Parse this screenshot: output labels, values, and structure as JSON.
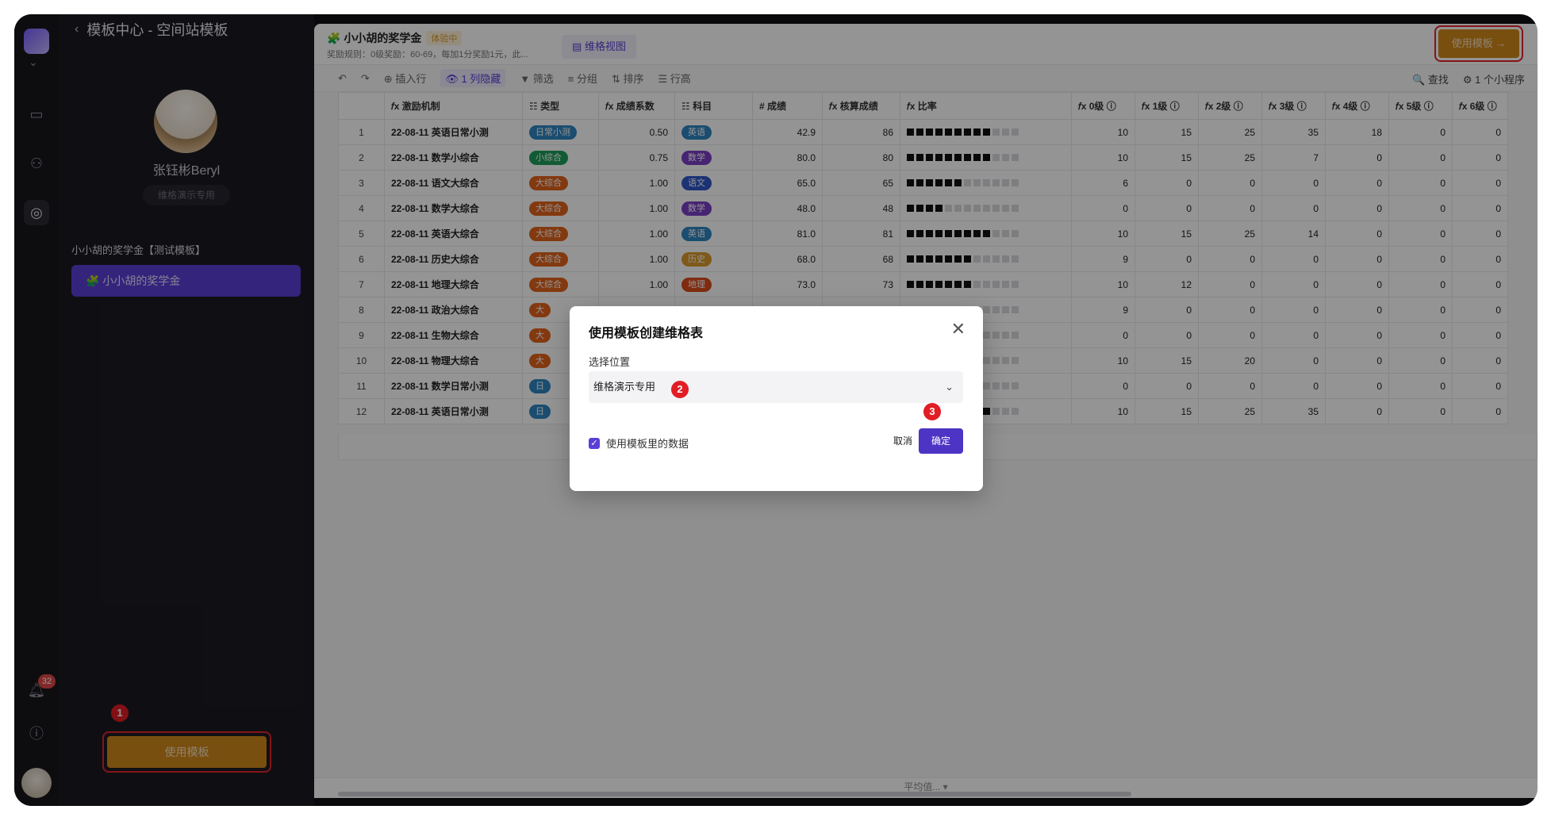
{
  "rail": {
    "badge_count": "32"
  },
  "side": {
    "header": "模板中心 - 空间站模板",
    "user_name": "张钰彬Beryl",
    "user_tag": "维格演示专用",
    "section_title": "小小胡的奖学金【测试模板】",
    "selected_item": "🧩 小小胡的奖学金",
    "use_button": "使用模板"
  },
  "doc": {
    "title": "🧩 小小胡的奖学金",
    "trial_tag": "体验中",
    "desc": "奖励规则：0级奖励：60-69，每加1分奖励1元，此...",
    "view_tab": "▤ 维格视图",
    "top_use_button": "使用模板 →"
  },
  "toolbar": {
    "insert": "⊕ 插入行",
    "hidden": "👁 1 列隐藏",
    "filter": "▼ 筛选",
    "group": "≡ 分组",
    "sort": "⇅ 排序",
    "row_height": "☰ 行高",
    "find": "🔍 查找",
    "widgets": "⚙ 1 个小程序"
  },
  "table": {
    "headers": [
      "",
      "𝑓x 激励机制",
      "☷ 类型",
      "𝑓x 成绩系数",
      "☷ 科目",
      "# 成绩",
      "𝑓x 核算成绩",
      "𝑓x 比率",
      "𝑓x 0级 ⓘ",
      "𝑓x 1级 ⓘ",
      "𝑓x 2级 ⓘ",
      "𝑓x 3级 ⓘ",
      "𝑓x 4级 ⓘ",
      "𝑓x 5级 ⓘ",
      "𝑓x 6级 ⓘ"
    ],
    "rows": [
      {
        "n": "1",
        "mech": "22-08-11 英语日常小测",
        "type": "日常小测",
        "tc": "#2e86c1",
        "coef": "0.50",
        "subj": "英语",
        "sc": "#2e86c1",
        "score": "42.9",
        "calc": "86",
        "rate": 9,
        "l0": "10",
        "l1": "15",
        "l2": "25",
        "l3": "35",
        "l4": "18",
        "l5": "0",
        "l6": "0"
      },
      {
        "n": "2",
        "mech": "22-08-11 数学小综合",
        "type": "小综合",
        "tc": "#1e9e5a",
        "coef": "0.75",
        "subj": "数学",
        "sc": "#7b3fc7",
        "score": "80.0",
        "calc": "80",
        "rate": 9,
        "l0": "10",
        "l1": "15",
        "l2": "25",
        "l3": "7",
        "l4": "0",
        "l5": "0",
        "l6": "0"
      },
      {
        "n": "3",
        "mech": "22-08-11 语文大综合",
        "type": "大综合",
        "tc": "#e2621b",
        "coef": "1.00",
        "subj": "语文",
        "sc": "#3057c9",
        "score": "65.0",
        "calc": "65",
        "rate": 6,
        "l0": "6",
        "l1": "0",
        "l2": "0",
        "l3": "0",
        "l4": "0",
        "l5": "0",
        "l6": "0"
      },
      {
        "n": "4",
        "mech": "22-08-11 数学大综合",
        "type": "大综合",
        "tc": "#e2621b",
        "coef": "1.00",
        "subj": "数学",
        "sc": "#7b3fc7",
        "score": "48.0",
        "calc": "48",
        "rate": 4,
        "l0": "0",
        "l1": "0",
        "l2": "0",
        "l3": "0",
        "l4": "0",
        "l5": "0",
        "l6": "0"
      },
      {
        "n": "5",
        "mech": "22-08-11 英语大综合",
        "type": "大综合",
        "tc": "#e2621b",
        "coef": "1.00",
        "subj": "英语",
        "sc": "#2e86c1",
        "score": "81.0",
        "calc": "81",
        "rate": 9,
        "l0": "10",
        "l1": "15",
        "l2": "25",
        "l3": "14",
        "l4": "0",
        "l5": "0",
        "l6": "0"
      },
      {
        "n": "6",
        "mech": "22-08-11 历史大综合",
        "type": "大综合",
        "tc": "#e2621b",
        "coef": "1.00",
        "subj": "历史",
        "sc": "#d99a2b",
        "score": "68.0",
        "calc": "68",
        "rate": 7,
        "l0": "9",
        "l1": "0",
        "l2": "0",
        "l3": "0",
        "l4": "0",
        "l5": "0",
        "l6": "0"
      },
      {
        "n": "7",
        "mech": "22-08-11 地理大综合",
        "type": "大综合",
        "tc": "#e2621b",
        "coef": "1.00",
        "subj": "地理",
        "sc": "#d94a1b",
        "score": "73.0",
        "calc": "73",
        "rate": 7,
        "l0": "10",
        "l1": "12",
        "l2": "0",
        "l3": "0",
        "l4": "0",
        "l5": "0",
        "l6": "0"
      },
      {
        "n": "8",
        "mech": "22-08-11 政治大综合",
        "type": "大",
        "tc": "#e2621b",
        "coef": "",
        "subj": "",
        "sc": "",
        "score": "",
        "calc": "",
        "rate": 6,
        "l0": "9",
        "l1": "0",
        "l2": "0",
        "l3": "0",
        "l4": "0",
        "l5": "0",
        "l6": "0"
      },
      {
        "n": "9",
        "mech": "22-08-11 生物大综合",
        "type": "大",
        "tc": "#e2621b",
        "coef": "",
        "subj": "",
        "sc": "",
        "score": "",
        "calc": "",
        "rate": 4,
        "l0": "0",
        "l1": "0",
        "l2": "0",
        "l3": "0",
        "l4": "0",
        "l5": "0",
        "l6": "0"
      },
      {
        "n": "10",
        "mech": "22-08-11 物理大综合",
        "type": "大",
        "tc": "#e2621b",
        "coef": "",
        "subj": "",
        "sc": "",
        "score": "",
        "calc": "",
        "rate": 8,
        "l0": "10",
        "l1": "15",
        "l2": "20",
        "l3": "0",
        "l4": "0",
        "l5": "0",
        "l6": "0"
      },
      {
        "n": "11",
        "mech": "22-08-11 数学日常小测",
        "type": "日",
        "tc": "#2e86c1",
        "coef": "",
        "subj": "",
        "sc": "",
        "score": "",
        "calc": "",
        "rate": 4,
        "l0": "0",
        "l1": "0",
        "l2": "0",
        "l3": "0",
        "l4": "0",
        "l5": "0",
        "l6": "0"
      },
      {
        "n": "12",
        "mech": "22-08-11 英语日常小测",
        "type": "日",
        "tc": "#2e86c1",
        "coef": "",
        "subj": "",
        "sc": "",
        "score": "",
        "calc": "",
        "rate": 9,
        "l0": "10",
        "l1": "15",
        "l2": "25",
        "l3": "35",
        "l4": "0",
        "l5": "0",
        "l6": "0"
      }
    ]
  },
  "status": {
    "avg": "平均值... ▾"
  },
  "modal": {
    "title": "使用模板创建维格表",
    "label": "选择位置",
    "selected": "维格演示专用",
    "checkbox_label": "使用模板里的数据",
    "cancel": "取消",
    "confirm": "确定"
  },
  "markers": {
    "one": "1",
    "two": "2",
    "three": "3"
  }
}
